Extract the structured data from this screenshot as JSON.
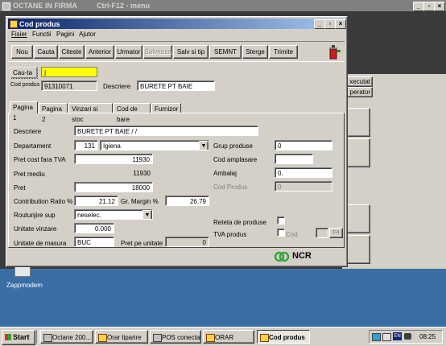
{
  "desktop": {
    "bg_title": "OCTANE IN FIRMA",
    "bg_hint": "Ctrl-F12 - menu",
    "side_btn_1": "xecutat",
    "side_btn_2": "perator",
    "desktop_icon_label": "Zappmodem"
  },
  "window": {
    "title": "Cod produs",
    "menu": [
      "Fisier",
      "Functii",
      "Pagini",
      "Ajutor"
    ]
  },
  "toolbar": {
    "buttons": [
      "Nou",
      "Cauta",
      "Citeste",
      "Anterior",
      "Urmator",
      "Salveaza",
      "Salv si tip",
      "SEMNT",
      "Sterge",
      "Trimite"
    ]
  },
  "search": {
    "cauta_label": "Cau-ta",
    "cauta_value": "|",
    "cod_produs_label": "Cod produs",
    "cod_produs_value": "91310071",
    "descriere_label": "Descriere",
    "descriere_value": "BURETE PT BAIE"
  },
  "tabs": [
    "Pagina 1",
    "Pagina 2",
    "Vinzari si stoc",
    "Cod de bare",
    "Furnizor"
  ],
  "form": {
    "descriere_label": "Descriere",
    "descriere_value": "BURETE PT BAIE  /  /",
    "departament_label": "Departament",
    "departament_code": "131",
    "departament_name": "Igiena",
    "pret_cost_label": "Pret cost fara TVA",
    "pret_cost_value": "11930",
    "pret_mediu_label": "Pret mediu",
    "pret_mediu_value": "11930",
    "pret_label": "Pret",
    "pret_value": "18000",
    "contribution_label": "Contribution Ratio %",
    "contribution_value": "21.12",
    "gr_margin_label": "Gr. Margin %",
    "gr_margin_value": "26.79",
    "rotunjire_label": "Routunjire sup",
    "rotunjire_value": "neselec.",
    "unitate_vinzare_label": "Unitate vinzare",
    "unitate_vinzare_value": "0.000",
    "unitate_masura_label": "Unitate de masura",
    "unitate_masura_value": "BUC",
    "pret_pe_unitate_label": "Pret pe unitate",
    "pret_pe_unitate_value": "0",
    "grup_produse_label": "Grup produse",
    "grup_produse_value": "0",
    "cod_amplasare_label": "Cod amplasare",
    "cod_amplasare_value": "",
    "ambalaj_label": "Ambalaj",
    "ambalaj_value": "0.",
    "cod_produs_label": "Cod Produs",
    "cod_produs_value": "0",
    "reteta_label": "Reteta de produse",
    "tva_label": "TVA produs",
    "cod_chk_label": "Cod",
    "f4_label": "F4"
  },
  "footer": {
    "logo_text": "NCR"
  },
  "taskbar": {
    "start": "Start",
    "tasks": [
      "Octane 200...",
      "Orar tiparire",
      "POS conectat",
      "ORAR",
      "Cod produs"
    ],
    "tray": [
      "EN"
    ],
    "clock": "08:25"
  },
  "colors": {
    "desktop": "#3a6ea5",
    "title_active": "#0a246a",
    "face": "#d4d0c8",
    "search_highlight": "#ffff00",
    "ncr_green": "#3aa53a"
  }
}
